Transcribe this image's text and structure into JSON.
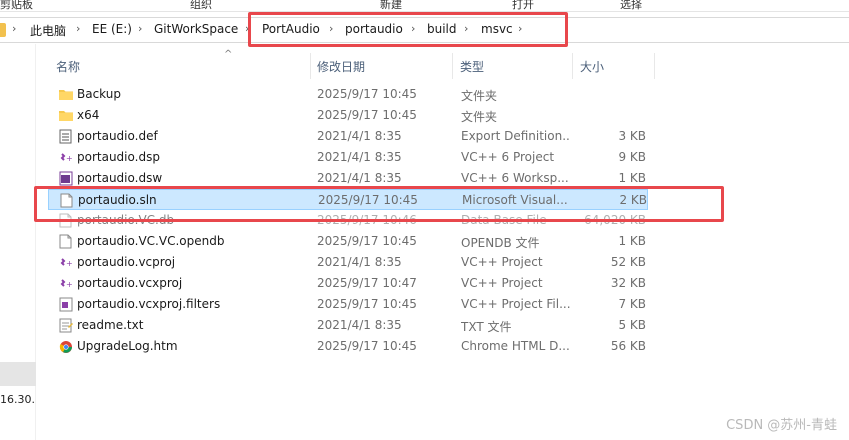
{
  "ribbon": {
    "items": [
      "剪贴板",
      "组织",
      "新建",
      "打开",
      "选择"
    ]
  },
  "address": {
    "segments": [
      "此电脑",
      "EE (E:)",
      "GitWorkSpace",
      "PortAudio",
      "portaudio",
      "build",
      "msvc"
    ],
    "separator": "›",
    "dropdown_glyph": "›"
  },
  "nav": {
    "partial_label": "16.30."
  },
  "columns": {
    "name": "名称",
    "date": "修改日期",
    "type": "类型",
    "size": "大小"
  },
  "files": [
    {
      "name": "Backup",
      "date": "2025/9/17 10:45",
      "type": "文件夹",
      "size": "",
      "icon": "folder-icon"
    },
    {
      "name": "x64",
      "date": "2025/9/17 10:45",
      "type": "文件夹",
      "size": "",
      "icon": "folder-icon"
    },
    {
      "name": "portaudio.def",
      "date": "2021/4/1 8:35",
      "type": "Export Definition...",
      "size": "3 KB",
      "icon": "def-file-icon"
    },
    {
      "name": "portaudio.dsp",
      "date": "2021/4/1 8:35",
      "type": "VC++ 6 Project",
      "size": "9 KB",
      "icon": "vc-project-icon"
    },
    {
      "name": "portaudio.dsw",
      "date": "2021/4/1 8:35",
      "type": "VC++ 6 Worksp...",
      "size": "1 KB",
      "icon": "vc-workspace-icon"
    },
    {
      "name": "portaudio.sln",
      "date": "2025/9/17 10:45",
      "type": "Microsoft Visual...",
      "size": "2 KB",
      "icon": "sln-file-icon",
      "selected": true
    },
    {
      "name": "portaudio.VC.db",
      "date": "2025/9/17 10:46",
      "type": "Data Base File",
      "size": "64,020 KB",
      "icon": "blank-file-icon",
      "obscured": true
    },
    {
      "name": "portaudio.VC.VC.opendb",
      "date": "2025/9/17 10:45",
      "type": "OPENDB 文件",
      "size": "1 KB",
      "icon": "blank-file-icon"
    },
    {
      "name": "portaudio.vcproj",
      "date": "2021/4/1 8:35",
      "type": "VC++ Project",
      "size": "52 KB",
      "icon": "vc-project-icon"
    },
    {
      "name": "portaudio.vcxproj",
      "date": "2025/9/17 10:47",
      "type": "VC++ Project",
      "size": "32 KB",
      "icon": "vc-project-icon"
    },
    {
      "name": "portaudio.vcxproj.filters",
      "date": "2025/9/17 10:45",
      "type": "VC++ Project Fil...",
      "size": "7 KB",
      "icon": "vc-filters-icon"
    },
    {
      "name": "readme.txt",
      "date": "2021/4/1 8:35",
      "type": "TXT 文件",
      "size": "5 KB",
      "icon": "txt-file-icon"
    },
    {
      "name": "UpgradeLog.htm",
      "date": "2025/9/17 10:45",
      "type": "Chrome HTML D...",
      "size": "56 KB",
      "icon": "chrome-html-icon"
    }
  ],
  "watermark": "CSDN @苏州-青蛙",
  "colors": {
    "highlight_red": "#e8474c",
    "selection_bg": "#cce8ff",
    "selection_border": "#99d1ff",
    "folder_yellow": "#f6c94e",
    "vc_purple": "#8b3fa8"
  }
}
